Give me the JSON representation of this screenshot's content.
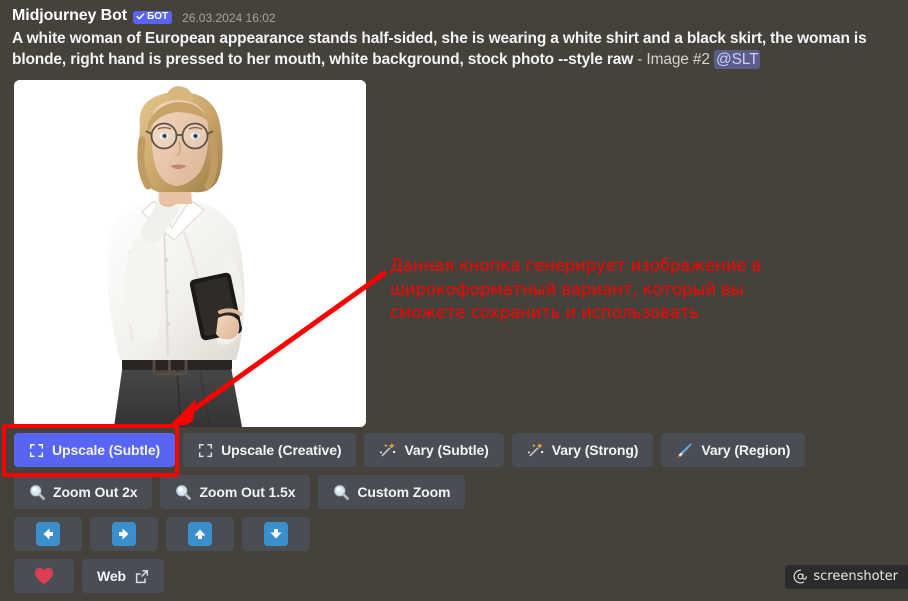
{
  "message": {
    "author": "Midjourney Bot",
    "badge_label": "БОТ",
    "badge_icon": "check-icon",
    "badge_color": "#5865f2",
    "timestamp": "26.03.2024 16:02",
    "prompt_line1": "A white woman of European appearance stands half-sided, she is wearing a white shirt and a black skirt, the woman is blonde,",
    "prompt_line2": "right hand is pressed to her mouth, white background, stock photo --style raw",
    "prompt_suffix": " - Image #2 ",
    "mention": "@SLT"
  },
  "attachment": {
    "alt": "Blonde woman with glasses in a white shirt and black skirt, right hand pressed to her mouth, holding a phone, white background",
    "image_number": "#2"
  },
  "buttons": {
    "row1": [
      {
        "label": "Upscale (Subtle)",
        "icon": "expand-icon",
        "style": "primary"
      },
      {
        "label": "Upscale (Creative)",
        "icon": "expand-icon",
        "style": "secondary"
      },
      {
        "label": "Vary (Subtle)",
        "icon": "magic-wand-icon",
        "style": "secondary"
      },
      {
        "label": "Vary (Strong)",
        "icon": "magic-wand-icon",
        "style": "secondary"
      },
      {
        "label": "Vary (Region)",
        "icon": "paintbrush-icon",
        "style": "secondary"
      }
    ],
    "row2": [
      {
        "label": "Zoom Out 2x",
        "icon": "magnifier-icon",
        "style": "secondary"
      },
      {
        "label": "Zoom Out 1.5x",
        "icon": "magnifier-icon",
        "style": "secondary"
      },
      {
        "label": "Custom Zoom",
        "icon": "magnifier-icon",
        "style": "secondary"
      }
    ],
    "row3": [
      {
        "label": "",
        "icon": "arrow-left-icon",
        "style": "secondary"
      },
      {
        "label": "",
        "icon": "arrow-right-icon",
        "style": "secondary"
      },
      {
        "label": "",
        "icon": "arrow-up-icon",
        "style": "secondary"
      },
      {
        "label": "",
        "icon": "arrow-down-icon",
        "style": "secondary"
      }
    ],
    "row4": [
      {
        "label": "",
        "icon": "heart-icon",
        "style": "secondary"
      },
      {
        "label": "Web",
        "icon": "external-link-icon",
        "style": "secondary"
      }
    ]
  },
  "annotation": {
    "color": "#fe0000",
    "line1": "Данная кнопка генерирует изображение в",
    "line2": "широкоформатный вариант, который вы",
    "line3": "сможете сохранить и использовать",
    "highlight_target": "Upscale (Subtle)"
  },
  "watermark": {
    "text": "screenshoter",
    "icon": "at-icon"
  },
  "colors": {
    "background": "#45413b",
    "button": "#4b4d55",
    "primary": "#5865f2",
    "annotation": "#fe0000",
    "mention_bg": "#5a5d87"
  }
}
